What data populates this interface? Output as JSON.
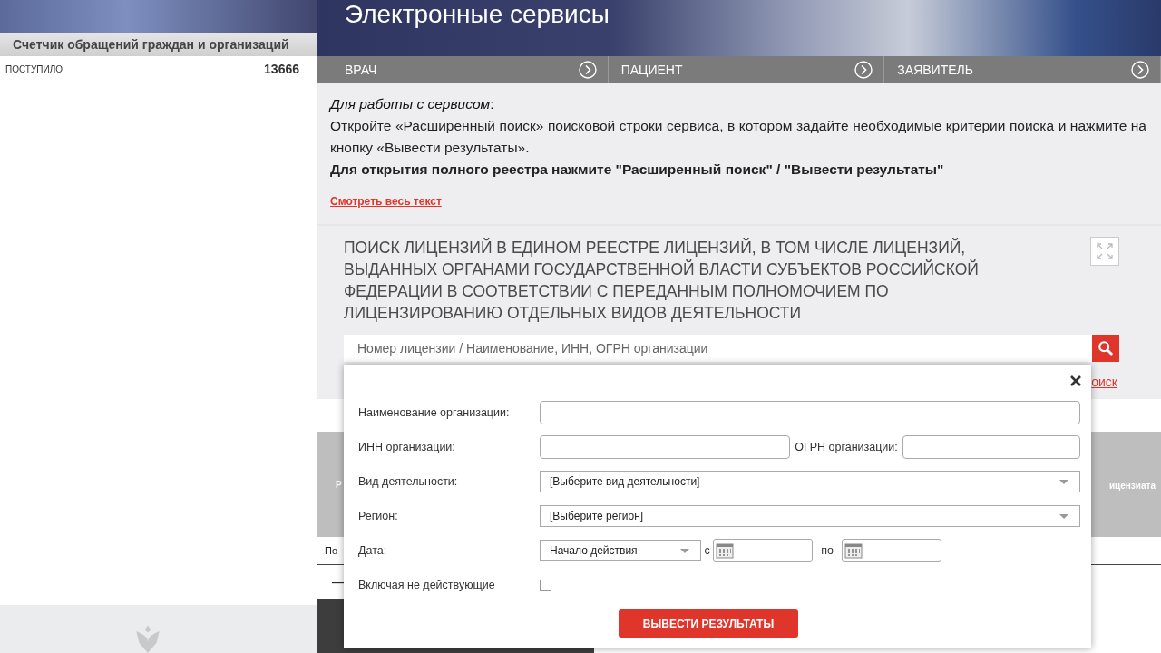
{
  "sidebar": {
    "counter_title": "Счетчик обращений граждан и организаций",
    "counter_label": "ПОСТУПИЛО",
    "counter_value": "13666"
  },
  "banner": {
    "title": "Электронные сервисы"
  },
  "nav": [
    {
      "label": "ВРАЧ"
    },
    {
      "label": "ПАЦИЕНТ"
    },
    {
      "label": "ЗАЯВИТЕЛЬ"
    }
  ],
  "info": {
    "heading": "*Для работы с сервисом*:",
    "text": "Откройте «Расширенный поиск» поисковой строки сервиса, в котором задайте необходимые критерии поиска и нажмите на кнопку «Вывести результаты».",
    "note": "Для открытия полного реестра нажмите \"Расширенный поиск\" / \"Вывести результаты\"",
    "link": "Смотреть весь текст"
  },
  "search": {
    "title": "ПОИСК ЛИЦЕНЗИЙ В ЕДИНОМ РЕЕСТРЕ ЛИЦЕНЗИЙ, В ТОМ ЧИСЛЕ ЛИЦЕНЗИЙ, ВЫДАННЫХ ОРГАНАМИ ГОСУДАРСТВЕННОЙ ВЛАСТИ СУБЪЕКТОВ РОССИЙСКОЙ ФЕДЕРАЦИИ В СООТВЕТСТВИИ С ПЕРЕДАННЫМ ПОЛНОМОЧИЕМ ПО ЛИЦЕНЗИРОВАНИЮ ОТДЕЛЬНЫХ ВИДОВ ДЕЯТЕЛЬНОСТИ",
    "placeholder": "Номер лицензии / Наименование, ИНН, ОГРН организации",
    "advanced_link": "оиск"
  },
  "results": {
    "header_left": "Р",
    "header_right": "ицензиата",
    "row_text": "По",
    "dash": "—"
  },
  "modal": {
    "fields": [
      {
        "kind": "text",
        "label": "Наименование организации:"
      },
      {
        "kind": "pair",
        "label": "ИНН организации:",
        "label2": "ОГРН организации:"
      },
      {
        "kind": "select",
        "label": "Вид деятельности:",
        "value": "[Выберите вид деятельности]"
      },
      {
        "kind": "select",
        "label": "Регион:",
        "value": "[Выберите регион]"
      },
      {
        "kind": "date",
        "label": "Дата:",
        "value": "Начало действия",
        "from": "с",
        "to": "по"
      },
      {
        "kind": "checkbox",
        "label": "Включая не действующие",
        "checked": false
      }
    ],
    "submit": "ВЫВЕСТИ РЕЗУЛЬТАТЫ"
  }
}
